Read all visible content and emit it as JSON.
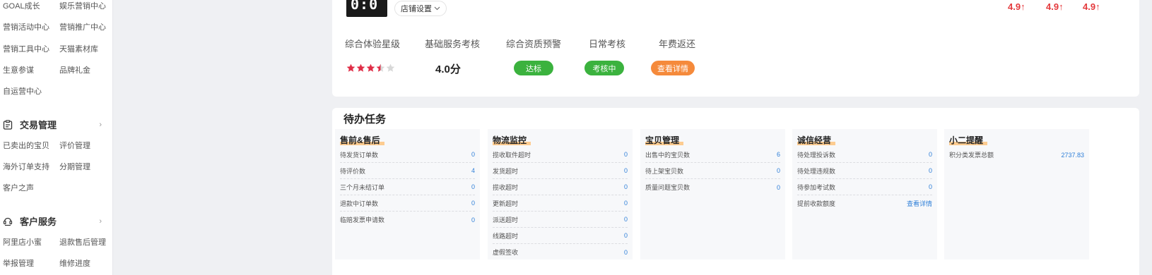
{
  "sidebar": {
    "links_top": [
      [
        "GOAL成长",
        "娱乐营销中心"
      ],
      [
        "营销活动中心",
        "营销推广中心"
      ],
      [
        "营销工具中心",
        "天猫素材库"
      ],
      [
        "生意参谋",
        "品牌礼金"
      ],
      [
        "自运营中心"
      ]
    ],
    "trade": {
      "title": "交易管理",
      "links": [
        [
          "已卖出的宝贝",
          "评价管理"
        ],
        [
          "海外订单支持",
          "分期管理"
        ],
        [
          "客户之声"
        ]
      ]
    },
    "service": {
      "title": "客户服务",
      "links": [
        [
          "阿里店小蜜",
          "退款售后管理"
        ],
        [
          "举报管理",
          "维修进度"
        ]
      ]
    }
  },
  "shop": {
    "logo_text": "0:0",
    "settings_label": "店铺设置",
    "scores": [
      "4.9↑",
      "4.9↑",
      "4.9↑"
    ]
  },
  "metrics": {
    "labels": [
      "综合体验星级",
      "基础服务考核",
      "综合资质预警",
      "日常考核",
      "年费返还"
    ],
    "star_rating": 3.5,
    "basic_service_score": "4.0分",
    "qualification_status": "达标",
    "daily_status": "考核中",
    "annual_fee_action": "查看详情"
  },
  "tasks": {
    "title": "待办任务",
    "columns": [
      {
        "title": "售前&售后",
        "rows": [
          {
            "label": "待发货订单数",
            "value": "0"
          },
          {
            "label": "待评价数",
            "value": "4"
          },
          {
            "label": "三个月未结订单",
            "value": "0"
          },
          {
            "label": "退款中订单数",
            "value": "0"
          },
          {
            "label": "临赔发票申请数",
            "value": "0"
          }
        ]
      },
      {
        "title": "物流监控",
        "rows": [
          {
            "label": "揽收取件超时",
            "value": "0"
          },
          {
            "label": "发货超时",
            "value": "0"
          },
          {
            "label": "揽收超时",
            "value": "0"
          },
          {
            "label": "更新超时",
            "value": "0"
          },
          {
            "label": "派送超时",
            "value": "0"
          },
          {
            "label": "线路超时",
            "value": "0"
          },
          {
            "label": "虚假签收",
            "value": "0"
          }
        ]
      },
      {
        "title": "宝贝管理",
        "rows": [
          {
            "label": "出售中的宝贝数",
            "value": "6"
          },
          {
            "label": "待上架宝贝数",
            "value": "0"
          },
          {
            "label": "质量问题宝贝数",
            "value": "0"
          }
        ]
      },
      {
        "title": "诚信经营",
        "rows": [
          {
            "label": "待处理投诉数",
            "value": "0"
          },
          {
            "label": "待处理违规数",
            "value": "0"
          },
          {
            "label": "待参加考试数",
            "value": "0"
          },
          {
            "label": "提前收款额度",
            "value": "查看详情"
          }
        ]
      },
      {
        "title": "小二提醒",
        "rows": [
          {
            "label": "积分类发票总额",
            "value": "2737.83"
          }
        ]
      }
    ]
  },
  "colors": {
    "accent_red": "#e4393c",
    "link_blue": "#2f7fd8",
    "green": "#3bb23e",
    "orange": "#f58a3b",
    "highlight": "#ffbd6c",
    "star_filled": "#e02e47",
    "star_empty": "#d8d8d8"
  },
  "icons": {
    "trade": "clipboard-icon",
    "service": "customer-service-icon",
    "settings_dropdown": "chevron-down-icon"
  }
}
